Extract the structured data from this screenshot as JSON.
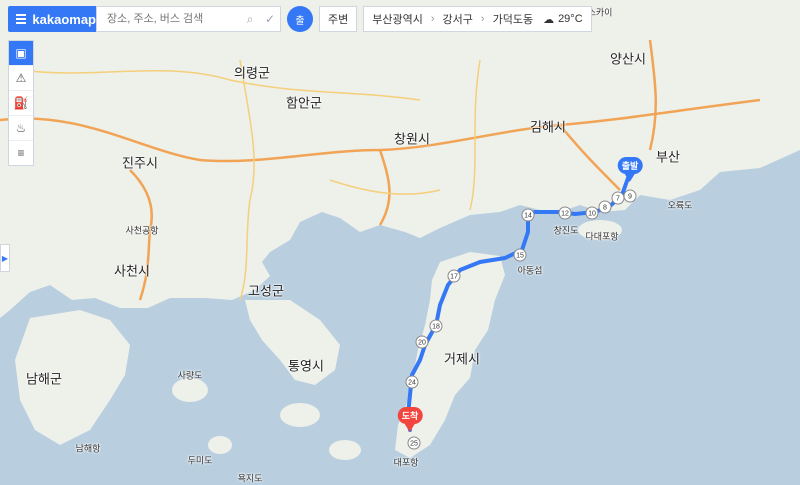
{
  "header": {
    "brand": "kakaomap",
    "search_placeholder": "장소, 주소, 버스 검색",
    "nearby_label": "주변",
    "location_pin_label": "출",
    "breadcrumb": [
      "부산광역시",
      "강서구",
      "가덕도동"
    ],
    "weather_temp": "29°C"
  },
  "sidebar": {
    "tools": [
      "cctv-icon",
      "warning-icon",
      "gas-station-icon",
      "restaurant-icon",
      "traffic-light-icon"
    ]
  },
  "route": {
    "start_label": "출발",
    "end_label": "도착",
    "color": "#3478f6",
    "road_numbers": [
      "14",
      "12",
      "10",
      "8",
      "7",
      "9",
      "15",
      "17",
      "18",
      "20",
      "24",
      "25"
    ]
  },
  "map_labels": {
    "cities": [
      "진주시",
      "사천시",
      "고성군",
      "통영시",
      "거제시",
      "창원시",
      "김해시",
      "부산",
      "양산시",
      "함안군",
      "의령군",
      "남해군"
    ],
    "places": [
      "사천공항",
      "아동섬",
      "대포항",
      "다대포항",
      "오륙도",
      "창진도",
      "사량도",
      "두미도",
      "스카이",
      "욕지도",
      "남해항"
    ],
    "temperature_note": "29°C"
  },
  "colors": {
    "sea": "#b9cfe0",
    "land": "#eef0ea",
    "highway": "#f1a455",
    "accent": "#3478f6"
  }
}
